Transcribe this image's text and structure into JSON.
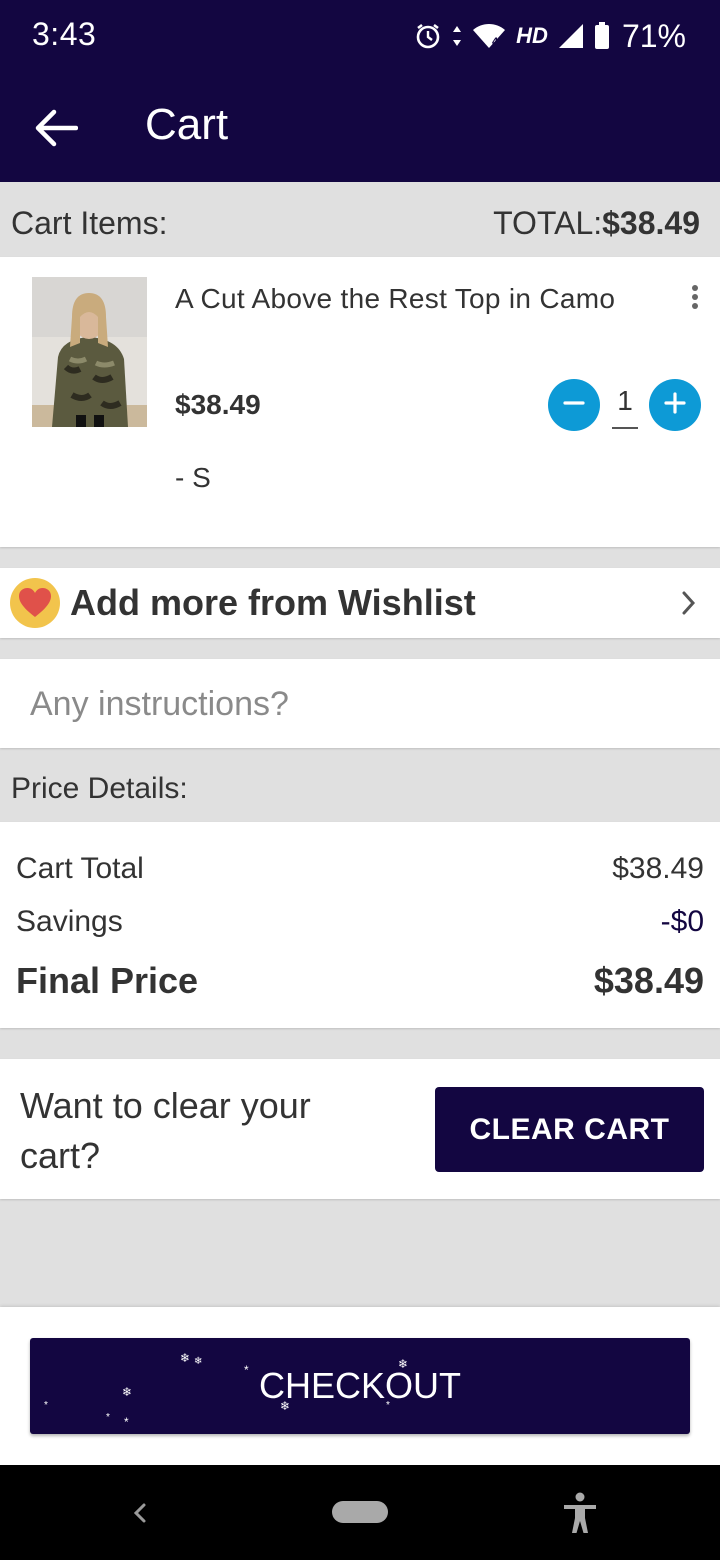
{
  "status_bar": {
    "time": "3:43",
    "network": "HD",
    "battery": "71%",
    "icons": [
      "alarm-icon",
      "data-arrows-icon",
      "wifi-icon",
      "signal-icon",
      "battery-icon"
    ]
  },
  "app_bar": {
    "title": "Cart",
    "back_icon": "arrow-left-icon"
  },
  "cart": {
    "items_label": "Cart Items:",
    "total_prefix": "TOTAL:",
    "total_value": "$38.49",
    "items": [
      {
        "name": "A Cut Above the Rest Top in Camo",
        "price": "$38.49",
        "quantity": "1",
        "variant": "- S"
      }
    ]
  },
  "wishlist": {
    "label": "Add more from Wishlist"
  },
  "instructions": {
    "placeholder": "Any instructions?"
  },
  "price_details": {
    "label": "Price Details:",
    "cart_total_label": "Cart Total",
    "cart_total_value": "$38.49",
    "savings_label": "Savings",
    "savings_value": "-$0",
    "final_label": "Final Price",
    "final_value": "$38.49"
  },
  "clear_cart": {
    "question": "Want to clear your cart?",
    "button_label": "CLEAR CART"
  },
  "checkout": {
    "button_label": "CHECKOUT"
  },
  "colors": {
    "primary": "#130641",
    "accent": "#0d9ad6",
    "background": "#e0e0e0"
  }
}
